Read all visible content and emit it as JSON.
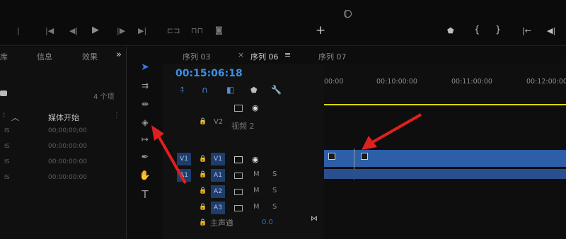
{
  "top": {
    "play_icon": "▶",
    "step_back_icon": "◀◀",
    "step_fwd_icon": "▶▶",
    "add_icon": "+",
    "marker_icon": "⬟",
    "brace_in": "{",
    "brace_out": "}",
    "go_in": "|←",
    "go_back": "◀|"
  },
  "left_panel": {
    "tabs": [
      "库",
      "信息",
      "效果"
    ],
    "more_icon": "»",
    "item_count": "4 个项",
    "column_header": "媒体开始",
    "rows": [
      "00;00;00;00",
      "00:00:00:00",
      "00:00:00:00",
      "00:00:00:00"
    ],
    "row_prefix": "IS"
  },
  "timeline": {
    "tabs": [
      "序列 03",
      "序列 06",
      "序列 07"
    ],
    "close_icon": "×",
    "menu_icon": "≡",
    "timecode": "00:15:06:18",
    "ruler_ticks": [
      "00:00",
      "00:10:00:00",
      "00:11:00:00",
      "00:12:00:00"
    ],
    "tracks": {
      "v2": {
        "label": "V2",
        "name": "视频 2"
      },
      "v1": {
        "src": "V1",
        "label": "V1"
      },
      "a1": {
        "src": "A1",
        "label": "A1",
        "m": "M",
        "s": "S"
      },
      "a2": {
        "label": "A2",
        "m": "M",
        "s": "S"
      },
      "a3": {
        "label": "A3",
        "m": "M",
        "s": "S"
      },
      "master": {
        "label": "主声道",
        "value": "0.0"
      }
    }
  },
  "colors": {
    "accent": "#2d5ea8",
    "timecode": "#3b8fe8",
    "playhead_bar": "#d9d900",
    "arrow": "#e0201e"
  }
}
